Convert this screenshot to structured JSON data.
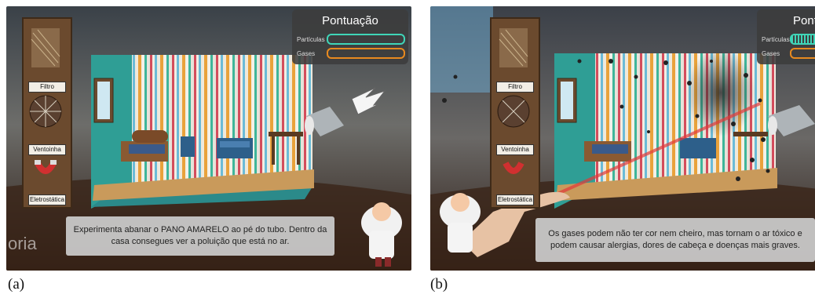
{
  "panels": [
    {
      "caption": "(a)",
      "toolbar": {
        "items": [
          "Filtro",
          "Ventoinha",
          "Eletrostática"
        ]
      },
      "score": {
        "title": "Pontuação",
        "rows": [
          "Partículas",
          "Gases"
        ]
      },
      "message": "Experimenta abanar o PANO AMARELO ao pé do tubo. Dentro da casa consegues ver a poluição que está no ar.",
      "watermark": "oria"
    },
    {
      "caption": "(b)",
      "toolbar": {
        "items": [
          "Filtro",
          "Ventoinha",
          "Eletrostática"
        ]
      },
      "score": {
        "title": "Pont",
        "rows": [
          "Partículas",
          "Gases"
        ]
      },
      "message": "Os gases podem não ter cor nem cheiro, mas tornam o ar tóxico e podem causar alergias, dores de cabeça e doenças mais graves."
    }
  ],
  "colors": {
    "particles_bar": "#3fd6b8",
    "gases_bar": "#e88a1f",
    "toolbar_wood": "#6b4a2e",
    "floor_wood": "#c99a5b"
  }
}
